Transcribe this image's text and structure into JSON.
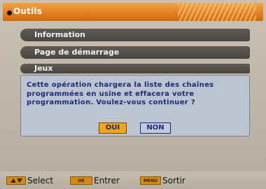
{
  "header": {
    "title": "Outils"
  },
  "menu": {
    "items": [
      {
        "label": "Information"
      },
      {
        "label": "Page de démarrage"
      },
      {
        "label": "Jeux"
      }
    ]
  },
  "dialog": {
    "message": "Cette opération chargera la liste des chaînes programmées en usine et effacera votre programmation. Voulez-vous continuer ?",
    "yes_label": "OUI",
    "no_label": "NON"
  },
  "footer": {
    "hints": [
      {
        "key": "up-down-arrows-key",
        "label": "Select"
      },
      {
        "key": "ok-key",
        "key_text": "OK",
        "label": "Entrer"
      },
      {
        "key": "menu-key",
        "key_text": "MENU",
        "label": "Sortir"
      }
    ]
  },
  "colors": {
    "header": "#e2811f",
    "menu_item": "#4f4b46",
    "dialog_bg": "#bcc4d2",
    "dialog_text": "#1b2a7a",
    "selected_button": "#f3a51a"
  }
}
